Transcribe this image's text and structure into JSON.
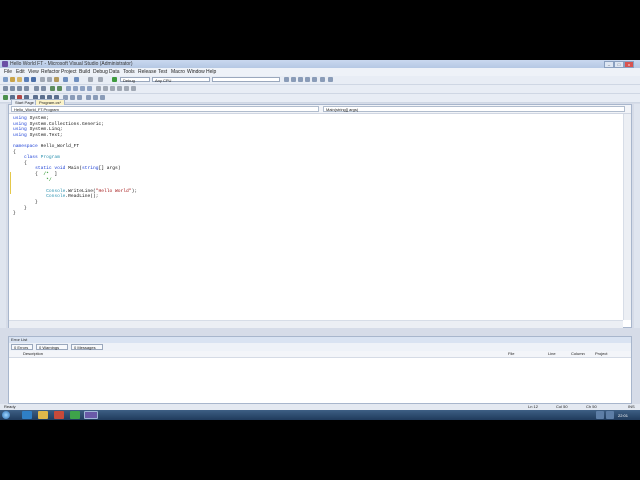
{
  "window": {
    "title": "Hello World FT - Microsoft Visual Studio (Administrator)",
    "minimize": "–",
    "maximize": "□",
    "close": "x"
  },
  "menu": [
    "File",
    "Edit",
    "View",
    "Refactor",
    "Project",
    "Build",
    "Debug",
    "Data",
    "Tools",
    "Release",
    "Test",
    "Macro",
    "Window",
    "Help"
  ],
  "toolbar": {
    "config": "Debug",
    "platform": "Any CPU"
  },
  "tabs": [
    "Start Page",
    "Program.cs*"
  ],
  "nav": {
    "class_combo": "Hello_World_FT.Program",
    "member_combo": "Main(string[] args)"
  },
  "code": [
    "using System;",
    "using System.Collections.Generic;",
    "using System.Linq;",
    "using System.Text;",
    "",
    "namespace Hello_World_FT",
    "{",
    "    class Program",
    "    {",
    "        static void Main(string[] args)",
    "        {  /*  ]",
    "            */",
    "",
    "            Console.WriteLine(\"Hello World\");",
    "            Console.ReadLine();",
    "        }",
    "    }",
    "}"
  ],
  "error_list": {
    "title": "Error List",
    "filters": [
      "0 Errors",
      "0 Warnings",
      "0 Messages"
    ],
    "columns": [
      "Description",
      "File",
      "Line",
      "Column",
      "Project"
    ]
  },
  "status": {
    "left": "Ready",
    "ln": "Ln 12",
    "col": "Col 50",
    "ch": "Ch 50",
    "mode": "INS"
  },
  "clock": "22:01",
  "colors": {
    "keyword": "#1b3fd6",
    "type": "#2b91af",
    "string": "#a31515",
    "comment": "#008000"
  }
}
